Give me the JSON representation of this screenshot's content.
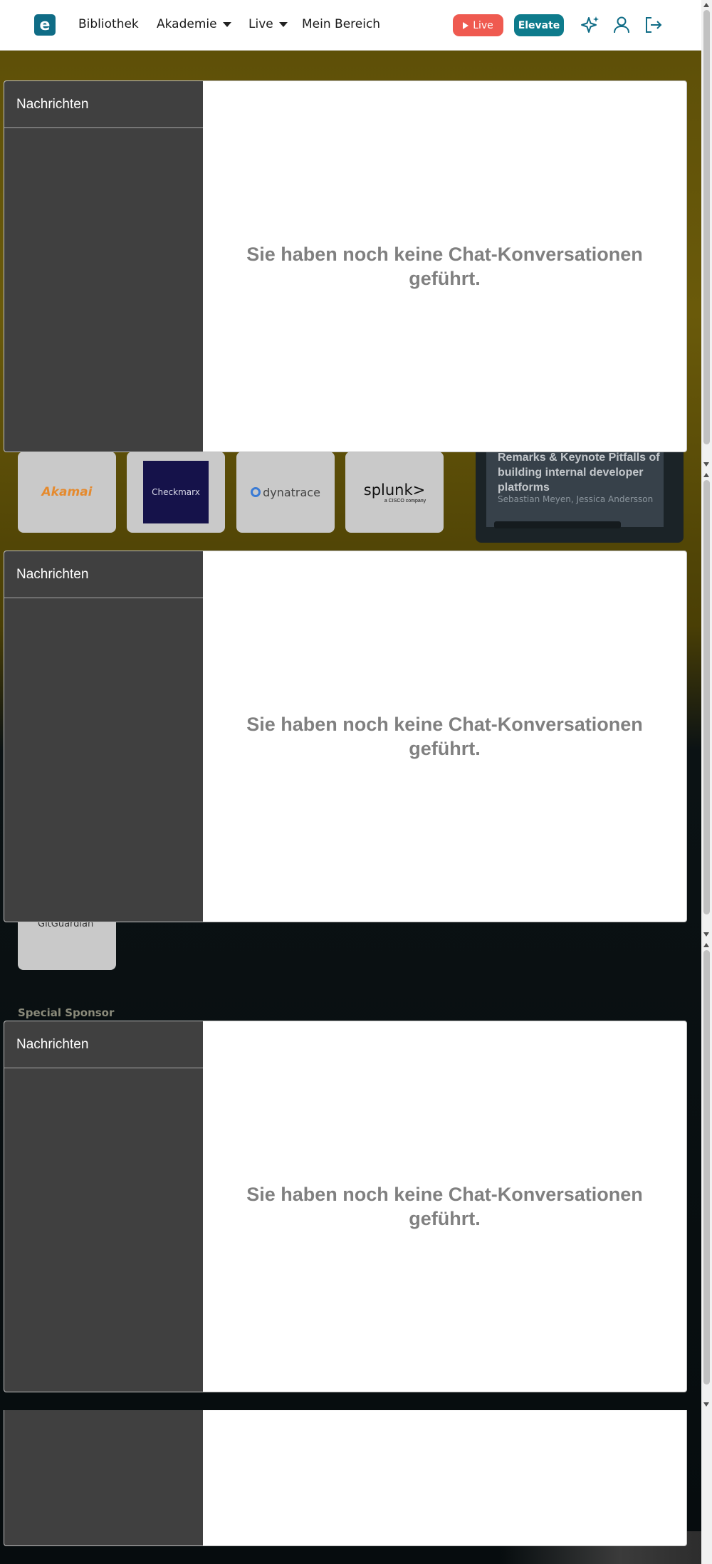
{
  "nav": {
    "logo_letter": "e",
    "items": [
      {
        "label": "Bibliothek"
      },
      {
        "label": "Akademie"
      },
      {
        "label": "Live"
      },
      {
        "label": "Mein Bereich"
      }
    ],
    "live_button": "Live",
    "elevate_button": "Elevate",
    "icons": [
      "sparkle-icon",
      "user-icon",
      "logout-icon"
    ]
  },
  "sponsors": {
    "logos": [
      "Akamai",
      "Checkmarx",
      "dynatrace",
      "splunk>"
    ],
    "splunk_sub": "a CISCO company",
    "card2_text": "GitGuardian",
    "special_label": "Special Sponsor"
  },
  "talk": {
    "title": "Remarks & Keynote Pitfalls of building internal developer platforms",
    "speakers": "Sebastian Meyen, Jessica Andersson"
  },
  "chat": {
    "header": "Nachrichten",
    "empty_message": "Sie haben noch keine Chat-Konversationen geführt."
  },
  "colors": {
    "brand": "#0f6c86",
    "live": "#ef5a50",
    "elevate": "#0e7b8c",
    "chat_sidebar": "#404040"
  }
}
